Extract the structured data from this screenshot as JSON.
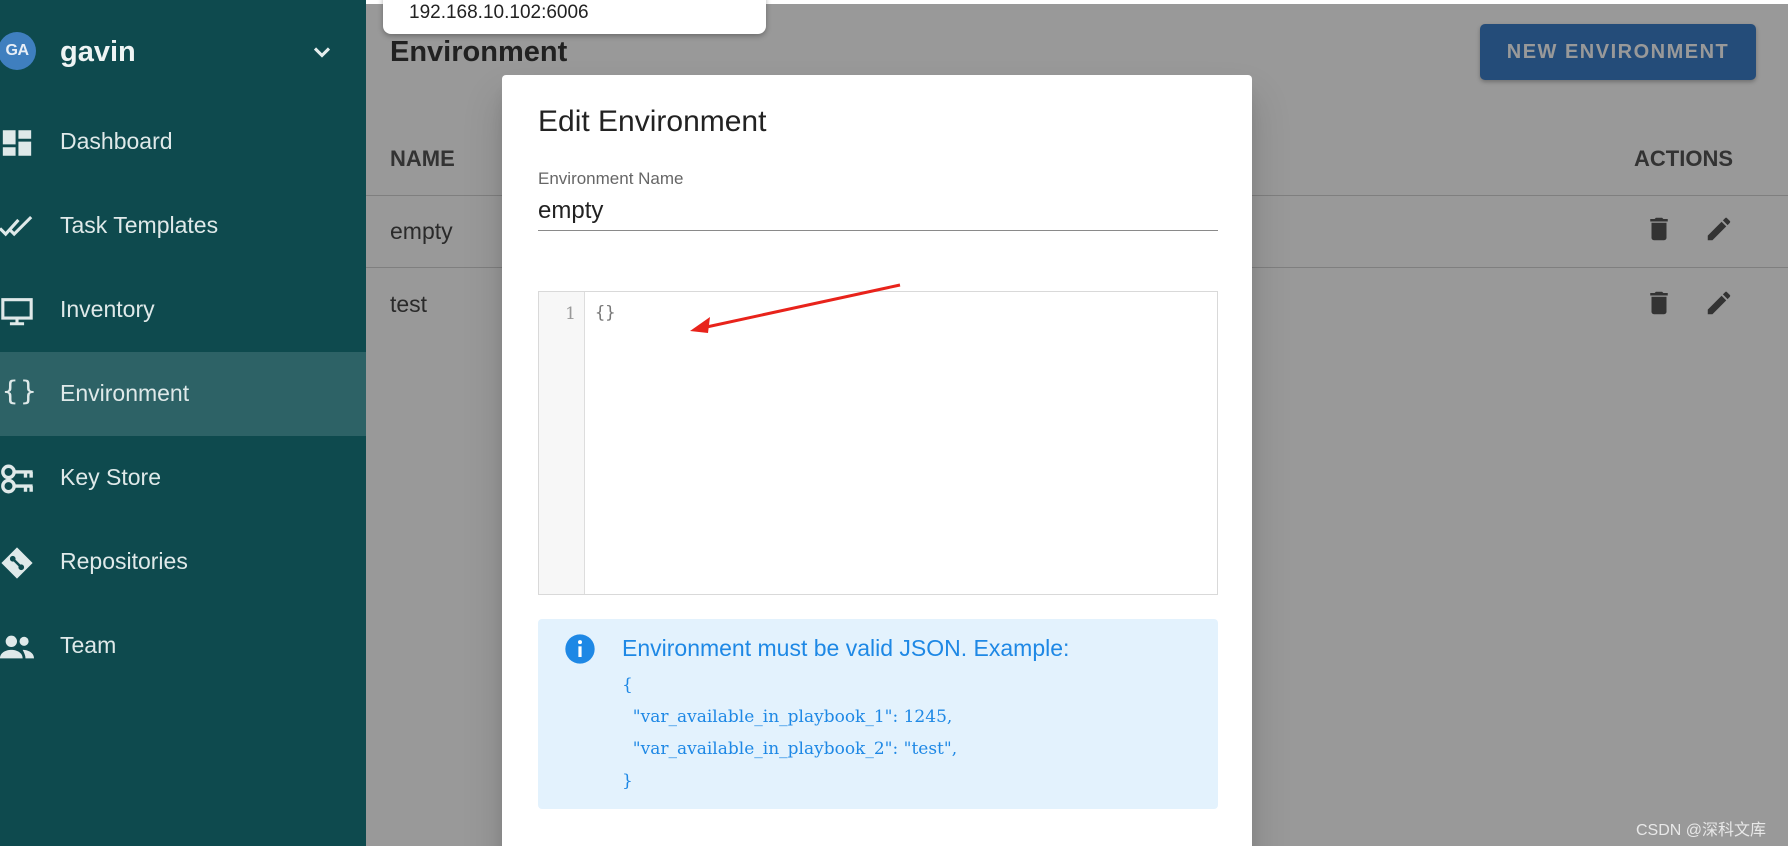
{
  "sidebar": {
    "avatar_initials": "GA",
    "username": "gavin",
    "items": [
      {
        "label": "Dashboard",
        "icon": "dashboard-icon"
      },
      {
        "label": "Task Templates",
        "icon": "double-check-icon"
      },
      {
        "label": "Inventory",
        "icon": "monitor-icon"
      },
      {
        "label": "Environment",
        "icon": "braces-icon",
        "active": true
      },
      {
        "label": "Key Store",
        "icon": "key-icon"
      },
      {
        "label": "Repositories",
        "icon": "git-icon"
      },
      {
        "label": "Team",
        "icon": "team-icon"
      }
    ],
    "braces_glyph": "{}"
  },
  "main": {
    "title": "Environment",
    "new_button": "NEW ENVIRONMENT",
    "table": {
      "headers": [
        "NAME",
        "ACTIONS"
      ],
      "rows": [
        {
          "name": "empty"
        },
        {
          "name": "test"
        }
      ]
    }
  },
  "url_popup": {
    "text": "192.168.10.102:6006"
  },
  "dialog": {
    "title": "Edit Environment",
    "field_label": "Environment Name",
    "field_value": "empty",
    "editor": {
      "line_number": "1",
      "code": "{}"
    },
    "alert": {
      "text": "Environment must be valid JSON. Example:",
      "code": "{\n  \"var_available_in_playbook_1\": 1245,\n  \"var_available_in_playbook_2\": \"test\",\n}"
    }
  },
  "watermark": "CSDN @深科文库",
  "colors": {
    "sidebar_bg": "#0e4a4e",
    "sidebar_active": "#2d6266",
    "primary_button": "#2771c4",
    "info_blue": "#1e88e5",
    "info_bg": "#e3f2fd",
    "annotation_arrow": "#e8231b"
  }
}
